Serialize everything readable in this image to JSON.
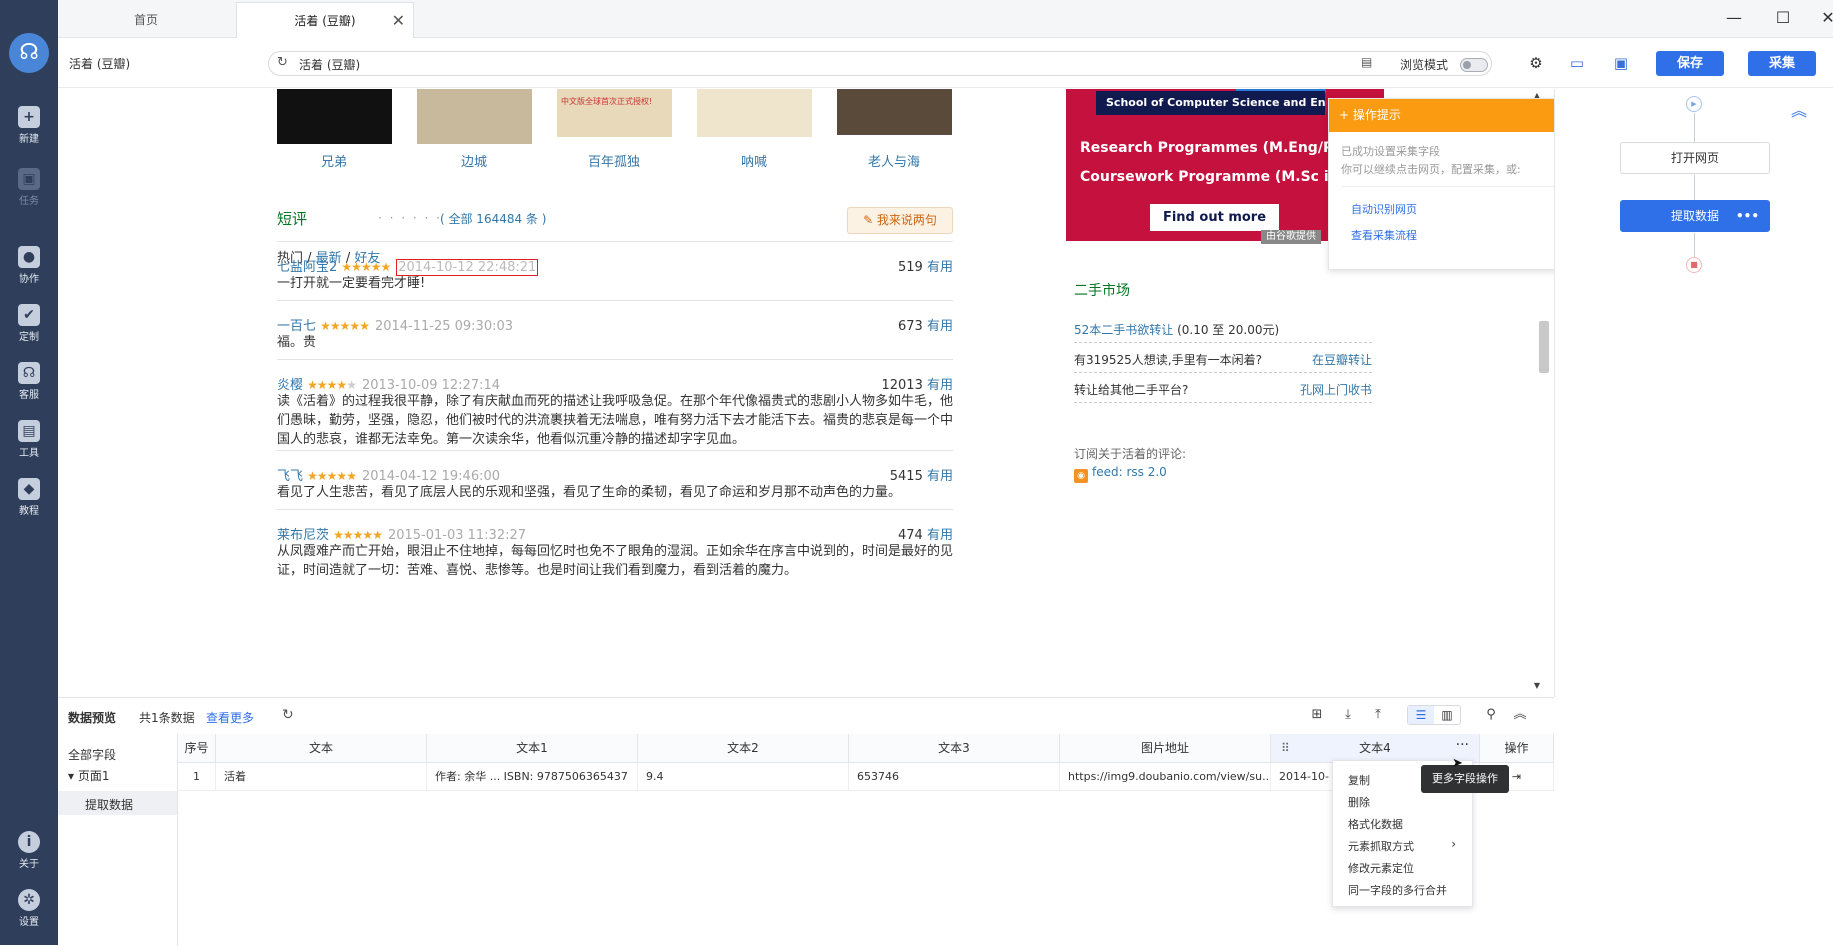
{
  "tabs": {
    "home": "首页",
    "active": "活着 (豆瓣)"
  },
  "window": {
    "minimize": "—",
    "maximize": "☐",
    "close": "✕"
  },
  "sidebar": {
    "items": [
      {
        "label": "新建",
        "icon": "+"
      },
      {
        "label": "任务",
        "icon": "▣"
      },
      {
        "label": "协作",
        "icon": "●"
      },
      {
        "label": "定制",
        "icon": "✔"
      },
      {
        "label": "客服",
        "icon": "☊"
      },
      {
        "label": "工具",
        "icon": "▤"
      },
      {
        "label": "教程",
        "icon": "◆"
      },
      {
        "label": "关于",
        "icon": "i"
      },
      {
        "label": "设置",
        "icon": "✲"
      }
    ]
  },
  "address": {
    "page_title": "活着 (豆瓣)",
    "url": "活着 (豆瓣)",
    "browse_mode": "浏览模式",
    "save": "保存",
    "collect": "采集"
  },
  "web": {
    "books": [
      "兄弟",
      "边城",
      "百年孤独",
      "呐喊",
      "老人与海"
    ],
    "thumb_banner": "中文版全球首次正式授权!",
    "short_review": {
      "heading": "短评",
      "dots": "· · · · · ·",
      "count_text": "( 全部 164484 条 )",
      "say_button": "✎ 我来说两句",
      "filter_hot": "热门",
      "filter_new": "最新",
      "filter_friends": "好友",
      "sep": " / "
    },
    "reviews": [
      {
        "user": "七盐阿宝2",
        "stars": 5,
        "date": "2014-10-12 22:48:21",
        "votes": "519",
        "useful": "有用",
        "text": "一打开就一定要看完才睡!"
      },
      {
        "user": "一百七",
        "stars": 5,
        "date": "2014-11-25 09:30:03",
        "votes": "673",
        "useful": "有用",
        "text": "福。贵"
      },
      {
        "user": "炎樱",
        "stars": 4,
        "date": "2013-10-09 12:27:14",
        "votes": "12013",
        "useful": "有用",
        "text": "读《活着》的过程我很平静，除了有庆献血而死的描述让我呼吸急促。在那个年代像福贵式的悲剧小人物多如牛毛，他们愚昧，勤劳，坚强，隐忍，他们被时代的洪流裹挟着无法喘息，唯有努力活下去才能活下去。福贵的悲哀是每一个中国人的悲哀，谁都无法幸免。第一次读余华，他看似沉重冷静的描述却字字见血。"
      },
      {
        "user": "飞飞",
        "stars": 5,
        "date": "2014-04-12 19:46:00",
        "votes": "5415",
        "useful": "有用",
        "text": "看见了人生悲苦，看见了底层人民的乐观和坚强，看见了生命的柔韧，看见了命运和岁月那不动声色的力量。"
      },
      {
        "user": "莱布尼茨",
        "stars": 5,
        "date": "2015-01-03 11:32:27",
        "votes": "474",
        "useful": "有用",
        "text": "从凤霞难产而亡开始，眼泪止不住地掉，每每回忆时也免不了眼角的湿润。正如余华在序言中说到的，时间是最好的见证，时间造就了一切：苦难、喜悦、悲惨等。也是时间让我们看到魔力，看到活着的魔力。"
      }
    ],
    "ad": {
      "school": "School of Computer Science and Engin",
      "line1": "Research Programmes (M.Eng/P",
      "line2": "Coursework Programme (M.Sc i",
      "button": "Find out more",
      "badge": "由谷歌提供"
    },
    "market": {
      "heading": "二手市场",
      "row1_link": "52本二手书欲转让",
      "row1_price": " (0.10 至 20.00元)",
      "row2_text": "有319525人想读,手里有一本闲着?",
      "row2_link": "在豆瓣转让",
      "row3_text": "转让给其他二手平台?",
      "row3_link": "孔网上门收书"
    },
    "rss": {
      "label": "订阅关于活着的评论:",
      "link": "feed: rss 2.0",
      "icon": "rss"
    }
  },
  "tip": {
    "title": "+ 操作提示",
    "collapse": "≈",
    "line1": "已成功设置采集字段",
    "line2": "你可以继续点击网页，配置采集，或:",
    "link1": "自动识别网页",
    "link2": "查看采集流程"
  },
  "flow": {
    "collapse": "︽",
    "start": "▶",
    "open": "打开网页",
    "extract": "提取数据",
    "extract_more": "•••",
    "end": "■"
  },
  "preview": {
    "title": "数据预览",
    "count": "共1条数据",
    "more": "查看更多",
    "tree_all": "全部字段",
    "tree_page": "页面1",
    "tree_extract": "提取数据",
    "columns": [
      "序号",
      "文本",
      "文本1",
      "文本2",
      "文本3",
      "图片地址",
      "文本4",
      "操作"
    ],
    "row": [
      "1",
      "活着",
      "作者: 余华 ... ISBN: 9787506365437",
      "9.4",
      "653746",
      "https://img9.doubanio.com/view/su...",
      "2014-10-"
    ]
  },
  "context_menu": {
    "items": [
      "复制",
      "删除",
      "格式化数据",
      "元素抓取方式",
      "修改元素定位",
      "同一字段的多行合并"
    ],
    "tooltip": "更多字段操作"
  },
  "colors": {
    "sidebar": "#2f3f5b",
    "primary": "#2f6fe8",
    "douban_green": "#007722",
    "link": "#3377aa",
    "tip_orange": "#fa9b12"
  }
}
